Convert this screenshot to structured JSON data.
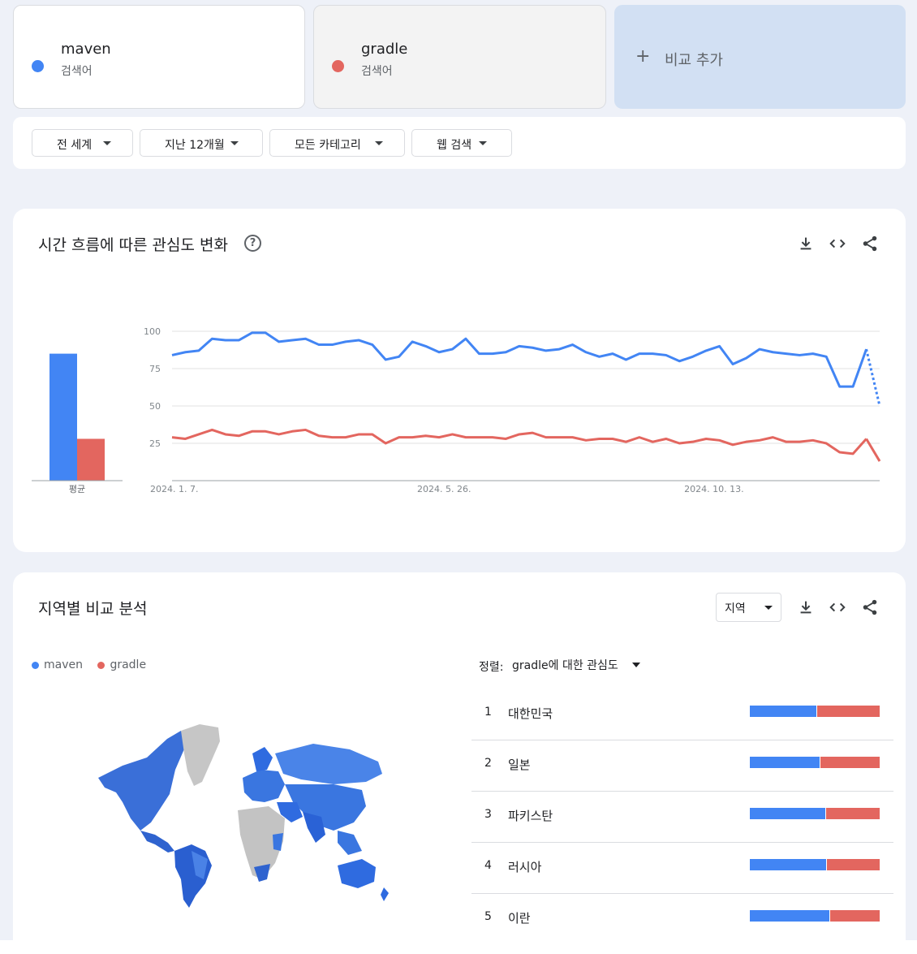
{
  "colors": {
    "maven": "#4285f4",
    "gradle": "#e3665f"
  },
  "terms": [
    {
      "name": "maven",
      "sub": "검색어",
      "color": "#4285f4"
    },
    {
      "name": "gradle",
      "sub": "검색어",
      "color": "#e3665f"
    }
  ],
  "add_compare": {
    "icon": "plus-icon",
    "plus": "+",
    "label": "비교 추가"
  },
  "filters": [
    {
      "label": "전 세계"
    },
    {
      "label": "지난 12개월"
    },
    {
      "label": "모든 카테고리"
    },
    {
      "label": "웹 검색"
    }
  ],
  "interest_over_time": {
    "title": "시간 흐름에 따른 관심도 변화",
    "help": "?",
    "avg_label": "평균",
    "icons": [
      "download-icon",
      "embed-icon",
      "share-icon"
    ]
  },
  "chart_data": {
    "type": "line",
    "x_labels": [
      "2024. 1. 7.",
      "2024. 5. 26.",
      "2024. 10. 13."
    ],
    "y_ticks": [
      100,
      75,
      50,
      25
    ],
    "ylim": [
      0,
      100
    ],
    "grid": true,
    "partial_last_point": true,
    "averages": [
      {
        "name": "maven",
        "value": 85
      },
      {
        "name": "gradle",
        "value": 28
      }
    ],
    "series": [
      {
        "name": "maven",
        "color": "#4285f4",
        "values": [
          84,
          86,
          87,
          95,
          94,
          94,
          99,
          99,
          93,
          94,
          95,
          91,
          91,
          93,
          94,
          91,
          81,
          83,
          93,
          90,
          86,
          88,
          95,
          85,
          85,
          86,
          90,
          89,
          87,
          88,
          91,
          86,
          83,
          85,
          81,
          85,
          85,
          84,
          80,
          83,
          87,
          90,
          78,
          82,
          88,
          86,
          85,
          84,
          85,
          83,
          63,
          63,
          88,
          50
        ]
      },
      {
        "name": "gradle",
        "color": "#e3665f",
        "values": [
          29,
          28,
          31,
          34,
          31,
          30,
          33,
          33,
          31,
          33,
          34,
          30,
          29,
          29,
          31,
          31,
          25,
          29,
          29,
          30,
          29,
          31,
          29,
          29,
          29,
          28,
          31,
          32,
          29,
          29,
          29,
          27,
          28,
          28,
          26,
          29,
          26,
          28,
          25,
          26,
          28,
          27,
          24,
          26,
          27,
          29,
          26,
          26,
          27,
          25,
          19,
          18,
          28,
          13
        ]
      }
    ]
  },
  "region": {
    "title": "지역별 비교 분석",
    "select_label": "지역",
    "legend": [
      "maven",
      "gradle"
    ],
    "sort_prefix": "정렬:",
    "sort_value": "gradle에 대한 관심도",
    "map_icon": "world-map",
    "icons": [
      "download-icon",
      "embed-icon",
      "share-icon"
    ],
    "rows": [
      {
        "rank": "1",
        "name": "대한민국",
        "maven": 51,
        "gradle": 49
      },
      {
        "rank": "2",
        "name": "일본",
        "maven": 54,
        "gradle": 46
      },
      {
        "rank": "3",
        "name": "파키스탄",
        "maven": 58,
        "gradle": 42
      },
      {
        "rank": "4",
        "name": "러시아",
        "maven": 59,
        "gradle": 41
      },
      {
        "rank": "5",
        "name": "이란",
        "maven": 61,
        "gradle": 39
      }
    ]
  }
}
